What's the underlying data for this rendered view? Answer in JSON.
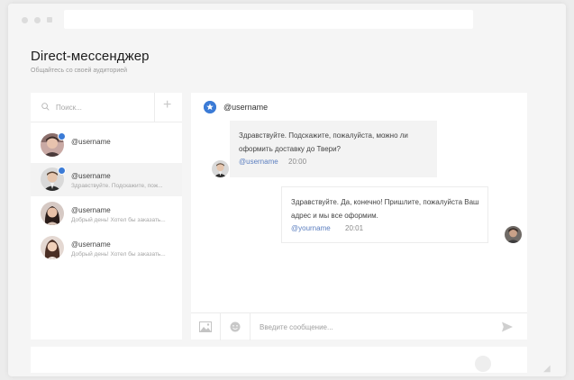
{
  "app": {
    "title": "Direct-мессенджер",
    "subtitle": "Общайтесь со своей аудиторией"
  },
  "search": {
    "placeholder": "Поиск..."
  },
  "add_button": {
    "label": "+"
  },
  "contacts": [
    {
      "name": "@username",
      "message": "",
      "has_badge": true,
      "active": false
    },
    {
      "name": "@username",
      "message": "Здравствуйте. Подскажите, пож...",
      "has_badge": true,
      "active": true
    },
    {
      "name": "@username",
      "message": "Добрый день! Хотел бы заказать...",
      "has_badge": false,
      "active": false
    },
    {
      "name": "@username",
      "message": "Добрый день! Хотел бы заказать...",
      "has_badge": false,
      "active": false
    }
  ],
  "chat": {
    "header_user": "@username",
    "messages": [
      {
        "direction": "incoming",
        "text": "Здравствуйте. Подскажите, пожалуйста, можно ли оформить доставку до Твери?",
        "user": "@username",
        "time": "20:00"
      },
      {
        "direction": "outgoing",
        "text": "Здравствуйте. Да, конечно! Пришлите, пожалуйста Ваш адрес и мы все оформим.",
        "user": "@yourname",
        "time": "20:01"
      }
    ],
    "composer_placeholder": "Введите сообщение..."
  },
  "icons": {
    "search": "search-icon",
    "add": "plus-icon",
    "badge": "star-badge-icon",
    "image": "image-icon",
    "emoji": "emoji-icon",
    "send": "send-icon"
  },
  "colors": {
    "accent": "#3b7bd6",
    "link": "#5c7fc0",
    "background": "#f5f5f5",
    "panel": "#ffffff"
  }
}
